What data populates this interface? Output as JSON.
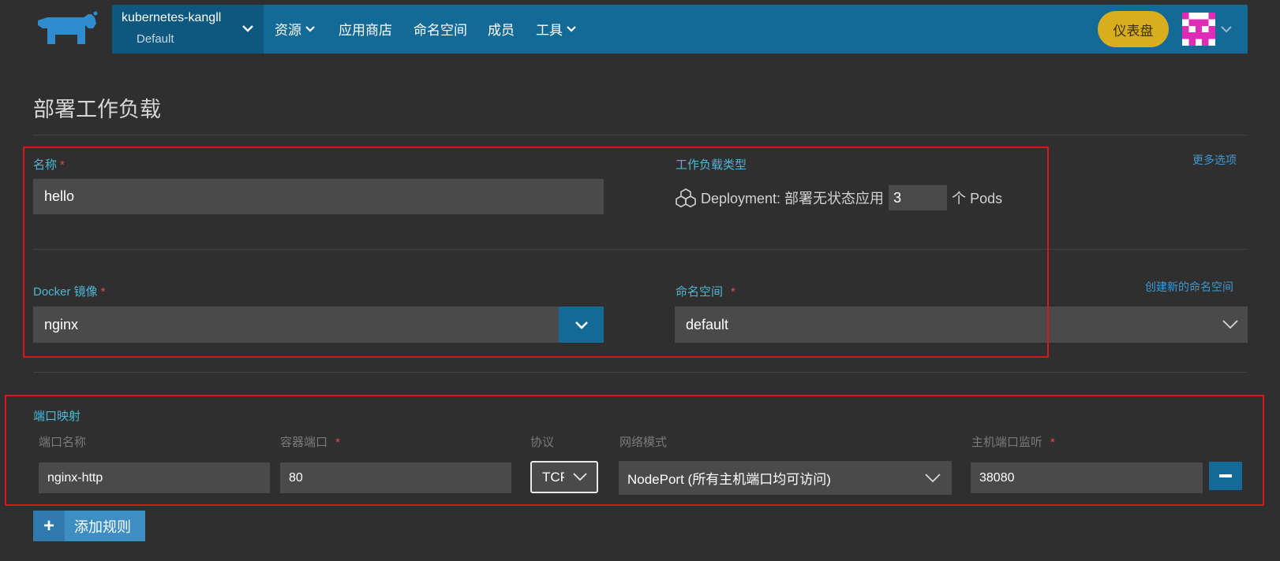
{
  "header": {
    "cluster_name": "kubernetes-kangll",
    "project_name": "Default",
    "nav": [
      {
        "label": "资源",
        "has_dropdown": true
      },
      {
        "label": "应用商店",
        "has_dropdown": false
      },
      {
        "label": "命名空间",
        "has_dropdown": false
      },
      {
        "label": "成员",
        "has_dropdown": false
      },
      {
        "label": "工具",
        "has_dropdown": true
      }
    ],
    "dashboard_label": "仪表盘",
    "colors": {
      "bar": "#146a96",
      "switcher": "#0e5880",
      "dashboard": "#d8ae1f",
      "avatar": "#e02ab8"
    }
  },
  "page": {
    "title": "部署工作负载",
    "more_options": "更多选项"
  },
  "form": {
    "name_label": "名称",
    "name_value": "hello",
    "workload_type_label": "工作负载类型",
    "workload_type_text": "Deployment: 部署无状态应用",
    "pods_value": "3",
    "pods_unit": "个 Pods",
    "docker_label": "Docker 镜像",
    "docker_value": "nginx",
    "namespace_label": "命名空间",
    "create_namespace_link": "创建新的命名空间",
    "namespace_value": "default",
    "required_mark": "*"
  },
  "ports": {
    "section_label": "端口映射",
    "columns": {
      "port_name": "端口名称",
      "container_port": "容器端口",
      "protocol": "协议",
      "network_mode": "网络模式",
      "host_port": "主机端口监听"
    },
    "row": {
      "port_name": "nginx-http",
      "container_port": "80",
      "protocol": "TCP",
      "network_mode": "NodePort (所有主机端口均可访问)",
      "host_port": "38080"
    },
    "add_rule_label": "添加规则"
  },
  "icons": [
    "rancher-logo-icon",
    "chevron-down-icon",
    "deployment-icon",
    "plus-icon",
    "minus-icon",
    "avatar-icon"
  ],
  "accent": {
    "label": "#4fb7d6",
    "required": "#e8474c",
    "link": "#3d98d3",
    "annotation": "#d8161d"
  }
}
